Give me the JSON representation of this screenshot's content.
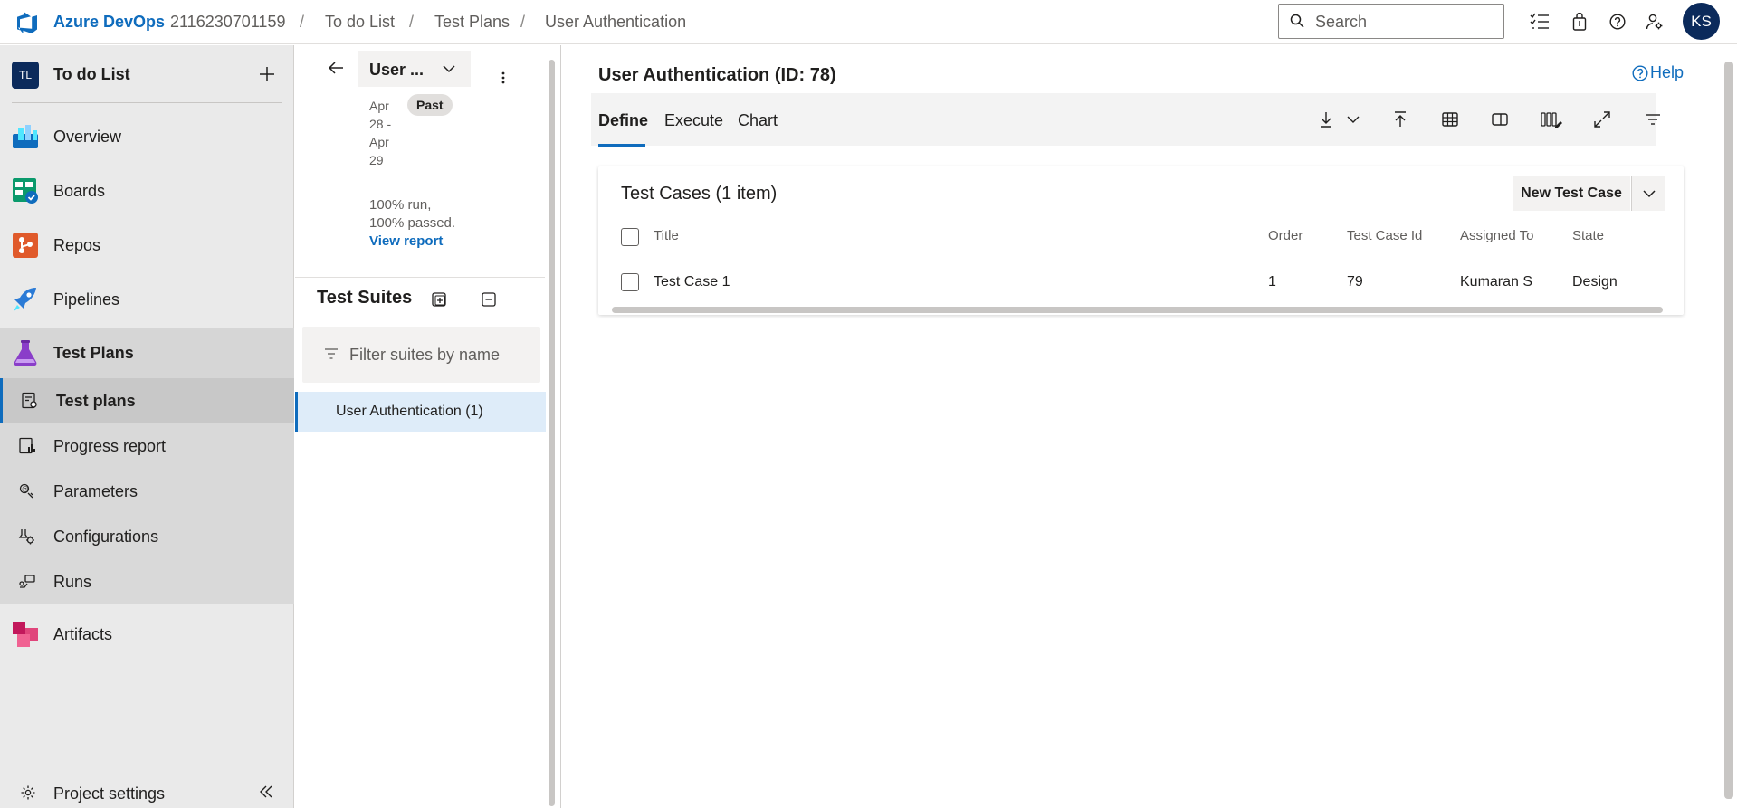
{
  "header": {
    "brand": "Azure DevOps",
    "org": "2116230701159",
    "breadcrumbs": [
      "To do List",
      "Test Plans",
      "User Authentication"
    ],
    "search_placeholder": "Search",
    "avatar_initials": "KS"
  },
  "leftnav": {
    "project_initials": "TL",
    "project_name": "To do List",
    "items": [
      {
        "label": "Overview",
        "icon": "overview-icon"
      },
      {
        "label": "Boards",
        "icon": "boards-icon"
      },
      {
        "label": "Repos",
        "icon": "repos-icon"
      },
      {
        "label": "Pipelines",
        "icon": "pipelines-icon"
      },
      {
        "label": "Test Plans",
        "icon": "test-plans-icon"
      },
      {
        "label": "Artifacts",
        "icon": "artifacts-icon"
      }
    ],
    "sub_items": [
      {
        "label": "Test plans",
        "icon": "test-plans-list-icon"
      },
      {
        "label": "Progress report",
        "icon": "progress-report-icon"
      },
      {
        "label": "Parameters",
        "icon": "parameters-icon"
      },
      {
        "label": "Configurations",
        "icon": "configurations-icon"
      },
      {
        "label": "Runs",
        "icon": "runs-icon"
      }
    ],
    "settings_label": "Project settings"
  },
  "plan": {
    "name": "User ...",
    "date_range": "Apr 28 - Apr 29",
    "status_badge": "Past",
    "run_summary": "100% run, 100% passed.",
    "report_link": "View report"
  },
  "suites": {
    "title": "Test Suites",
    "filter_placeholder": "Filter suites by name",
    "items": [
      {
        "label": "User Authentication (1)"
      }
    ]
  },
  "main": {
    "title": "User Authentication (ID: 78)",
    "help_label": "Help",
    "tabs": [
      "Define",
      "Execute",
      "Chart"
    ],
    "card_title": "Test Cases (1 item)",
    "new_button": "New Test Case",
    "columns": [
      "Title",
      "Order",
      "Test Case Id",
      "Assigned To",
      "State"
    ],
    "rows": [
      {
        "title": "Test Case 1",
        "order": "1",
        "id": "79",
        "assigned": "Kumaran S",
        "state": "Design"
      }
    ]
  }
}
